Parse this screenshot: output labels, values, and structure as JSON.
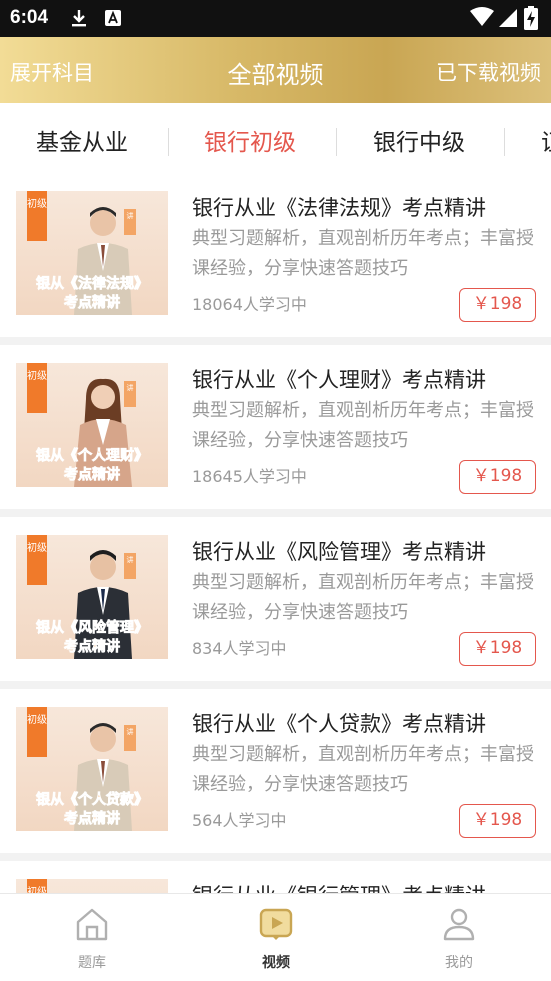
{
  "status": {
    "time": "6:04"
  },
  "header": {
    "left": "展开科目",
    "title": "全部视频",
    "right": "已下载视频"
  },
  "tabs": [
    {
      "label": "基金从业",
      "active": false
    },
    {
      "label": "银行初级",
      "active": true
    },
    {
      "label": "银行中级",
      "active": false
    },
    {
      "label": "证",
      "active": false
    }
  ],
  "courses": [
    {
      "title": "银行从业《法律法规》考点精讲",
      "desc": "典型习题解析，直观剖析历年考点；丰富授课经验，分享快速答题技巧",
      "learners": "18064人学习中",
      "price": "￥198",
      "thumb": {
        "badge": "初级",
        "line1": "银从《法律法规》",
        "line2": "考点精讲"
      }
    },
    {
      "title": "银行从业《个人理财》考点精讲",
      "desc": "典型习题解析，直观剖析历年考点；丰富授课经验，分享快速答题技巧",
      "learners": "18645人学习中",
      "price": "￥198",
      "thumb": {
        "badge": "初级",
        "line1": "银从《个人理财》",
        "line2": "考点精讲"
      }
    },
    {
      "title": "银行从业《风险管理》考点精讲",
      "desc": "典型习题解析，直观剖析历年考点；丰富授课经验，分享快速答题技巧",
      "learners": "834人学习中",
      "price": "￥198",
      "thumb": {
        "badge": "初级",
        "line1": "银从《风险管理》",
        "line2": "考点精讲"
      }
    },
    {
      "title": "银行从业《个人贷款》考点精讲",
      "desc": "典型习题解析，直观剖析历年考点；丰富授课经验，分享快速答题技巧",
      "learners": "564人学习中",
      "price": "￥198",
      "thumb": {
        "badge": "初级",
        "line1": "银从《个人贷款》",
        "line2": "考点精讲"
      }
    },
    {
      "title": "银行从业《银行管理》考点精讲",
      "desc": "",
      "learners": "",
      "price": "",
      "thumb": {
        "badge": "初级",
        "line1": "",
        "line2": ""
      }
    }
  ],
  "bottom_nav": [
    {
      "label": "题库",
      "icon": "house-icon",
      "active": false
    },
    {
      "label": "视频",
      "icon": "video-icon",
      "active": true
    },
    {
      "label": "我的",
      "icon": "person-icon",
      "active": false
    }
  ],
  "colors": {
    "accent": "#e4574d",
    "header_gold": "#d6b765",
    "badge_orange": "#f07a2a",
    "nav_active": "#c9a653"
  }
}
